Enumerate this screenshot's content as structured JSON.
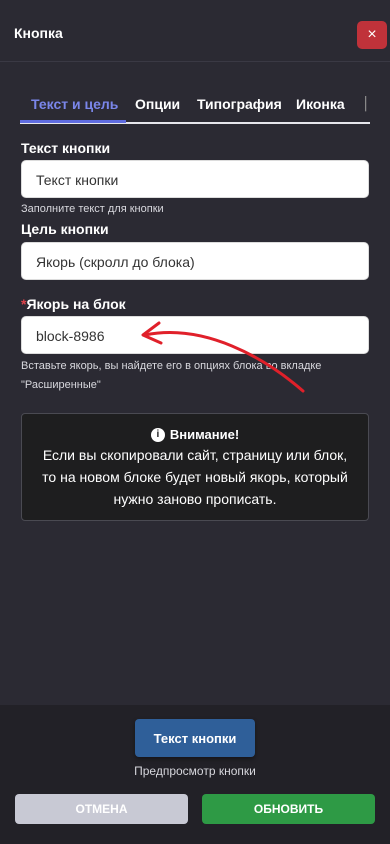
{
  "header": {
    "title": "Кнопка",
    "close_label": "×"
  },
  "tabs": [
    {
      "label": "Текст и цель",
      "active": true
    },
    {
      "label": "Опции",
      "active": false
    },
    {
      "label": "Типография",
      "active": false
    },
    {
      "label": "Иконка",
      "active": false
    }
  ],
  "form": {
    "button_text": {
      "label": "Текст кнопки",
      "value": "Текст кнопки",
      "hint": "Заполните текст для кнопки"
    },
    "target": {
      "label": "Цель кнопки",
      "value": "Якорь (скролл до блока)"
    },
    "anchor": {
      "required_mark": "*",
      "label": "Якорь на блок",
      "value": "block-8986",
      "hint": "Вставьте якорь, вы найдете его в опциях блока во вкладке \"Расширенные\""
    }
  },
  "alert": {
    "icon": "info-icon",
    "title": "Внимание!",
    "text": "Если вы скопировали сайт, страницу или блок, то на новом блоке будет новый якорь, который нужно заново прописать."
  },
  "footer": {
    "preview_button": "Текст кнопки",
    "preview_caption": "Предпросмотр кнопки",
    "cancel": "ОТМЕНА",
    "update": "ОБНОВИТЬ"
  },
  "colors": {
    "background": "#2b2a33",
    "accent_tab": "#7a86ea",
    "close": "#c0323a",
    "preview": "#2f5f99",
    "update": "#2e9a45",
    "cancel": "#c8c9d4",
    "arrow": "#e0202a"
  }
}
